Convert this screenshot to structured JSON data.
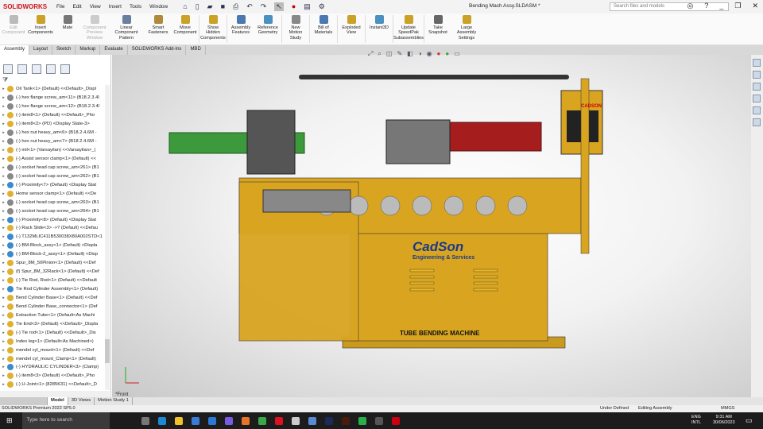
{
  "app": {
    "logo": "SOLIDWORKS",
    "title": "Bending Mach Assy.SLDASM *",
    "search_placeholder": "Search files and models"
  },
  "menu": [
    "File",
    "Edit",
    "View",
    "Insert",
    "Tools",
    "Window"
  ],
  "ribbon": [
    {
      "label": "Edit Component",
      "disabled": true,
      "color": "#bbb"
    },
    {
      "label": "Insert Components",
      "color": "#c9a227"
    },
    {
      "label": "Mate",
      "color": "#777"
    },
    {
      "label": "Component Preview Window",
      "disabled": true,
      "color": "#ccc"
    },
    {
      "label": "Linear Component Pattern",
      "color": "#6a7fa0"
    },
    {
      "label": "Smart Fasteners",
      "color": "#b08a3a"
    },
    {
      "label": "Move Component",
      "color": "#c9a227"
    },
    {
      "label": "Show Hidden Components",
      "color": "#c9a227"
    },
    {
      "label": "Assembly Features",
      "color": "#4a78b0"
    },
    {
      "label": "Reference Geometry",
      "color": "#4a90c0"
    },
    {
      "label": "New Motion Study",
      "color": "#888"
    },
    {
      "label": "Bill of Materials",
      "color": "#4a78b0"
    },
    {
      "label": "Exploded View",
      "color": "#c9a227"
    },
    {
      "label": "Instant3D",
      "color": "#4a90c0"
    },
    {
      "label": "Update SpeedPak Subassemblies",
      "color": "#c9a227"
    },
    {
      "label": "Take Snapshot",
      "color": "#666"
    },
    {
      "label": "Large Assembly Settings",
      "color": "#c9a227"
    }
  ],
  "tabs": [
    "Assembly",
    "Layout",
    "Sketch",
    "Markup",
    "Evaluate",
    "SOLIDWORKS Add-Ins",
    "MBD"
  ],
  "tree": [
    {
      "t": "Oil Tank<1> (Default) <<Default>_Displ",
      "k": "a"
    },
    {
      "t": "(-) hex flange screw_am<11> (B18.2.3.4l",
      "k": "p"
    },
    {
      "t": "(-) hex flange screw_am<12> (B18.2.3.4l",
      "k": "p"
    },
    {
      "t": "(-) item8<1> (Default) <<Default>_Pho",
      "k": "a"
    },
    {
      "t": "(-) item8<2> (PD) <Display State-3>",
      "k": "a"
    },
    {
      "t": "(-) hex nut heavy_am<6> (B18.2.4.6M -",
      "k": "p"
    },
    {
      "t": "(-) hex nut heavy_am<7> (B18.2.4.6M -",
      "k": "p"
    },
    {
      "t": "(-) mil<1> (Varsayilan) <<Varsayilan>_(",
      "k": "a"
    },
    {
      "t": "(-) Assist sensor clamp<1> (Default) <<",
      "k": "a"
    },
    {
      "t": "(-) socket head cap screw_am<261> (B1",
      "k": "p"
    },
    {
      "t": "(-) socket head cap screw_am<262> (B1",
      "k": "p"
    },
    {
      "t": "(-) Proximity<7> (Default) <Display Stat",
      "k": "b"
    },
    {
      "t": "Home sensor clamp<1> (Default) <<De",
      "k": "a"
    },
    {
      "t": "(-) socket head cap screw_am<263> (B1",
      "k": "p"
    },
    {
      "t": "(-) socket head cap screw_am<264> (B1",
      "k": "p"
    },
    {
      "t": "(-) Proximity<8> (Default) <Display Stat",
      "k": "b"
    },
    {
      "t": "(-) Rack Slide<3> ->? (Default) <<Defau",
      "k": "a"
    },
    {
      "t": "(-) T132MLIC411B530038X80A002STD<1",
      "k": "b"
    },
    {
      "t": "(-) BM-Block_assy<1> (Default) <Displa",
      "k": "b"
    },
    {
      "t": "(-) BM-Block-2_assy<1> (Default) <Disp",
      "k": "b"
    },
    {
      "t": "Spur_8M_50Pinion<1> (Default) <<Def",
      "k": "a"
    },
    {
      "t": "(f) Spur_8M_32Rack<1> (Default) <<Def",
      "k": "a"
    },
    {
      "t": "(-) Tie Rod, Rod<1> (Default) <<Default",
      "k": "a"
    },
    {
      "t": "Tie Rod Cylinder Assembly<1> (Default)",
      "k": "b"
    },
    {
      "t": "Bend Cylinder Base<1> (Default) <<Def",
      "k": "a"
    },
    {
      "t": "Bend Cylinder Base_connector<1> (Def",
      "k": "a"
    },
    {
      "t": "Extraction Tube<1> (Default<As Machi",
      "k": "a"
    },
    {
      "t": "Tie End<3> (Default) <<Default>_Displa",
      "k": "a"
    },
    {
      "t": "(-) Tie rod<1> (Default) <<Default>_Dis",
      "k": "a"
    },
    {
      "t": "Index leg<1> (Default<As Machined>)",
      "k": "a"
    },
    {
      "t": "mendel cyl_mount<1> (Default) <<Def",
      "k": "a"
    },
    {
      "t": "mendel cyl_mount_Clamp<1> (Default)",
      "k": "a"
    },
    {
      "t": "(-) HYDRAULIC CYLINDER<3> (Clamp)",
      "k": "b"
    },
    {
      "t": "(-) item8<3> (Default) <<Default>_Pho",
      "k": "a"
    },
    {
      "t": "(-) U-Joint<1> (8285K31) <<Default>_D",
      "k": "a"
    }
  ],
  "viewport": {
    "view_label": "*Front",
    "brand": "CadSon",
    "brand_sub": "Engineering & Services",
    "machine_label": "TUBE BENDING MACHINE",
    "badge": "CADSON"
  },
  "bottom_tabs": [
    "Model",
    "3D Views",
    "Motion Study 1"
  ],
  "status": {
    "version": "SOLIDWORKS Premium 2022 SP5.0",
    "state": "Under Defined",
    "mode": "Editing Assembly",
    "units": "MMGS"
  },
  "taskbar": {
    "search": "Type here to search",
    "time": "9:31 AM",
    "date": "30/06/2023",
    "lang": "ENG",
    "layout": "INTL"
  },
  "colors": {
    "accent": "#d0121b",
    "machine": "#d9a521",
    "green": "#2e8b3a",
    "red": "#a31a1a"
  }
}
